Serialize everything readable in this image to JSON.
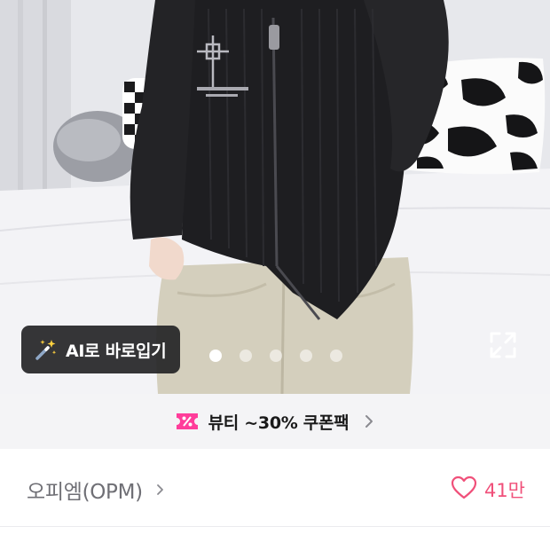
{
  "product_image": {
    "ai_fitting_label": "AI로 바로입기",
    "image_count": 5,
    "active_index": 0,
    "icons": {
      "ai_fitting": "magic-wand-icon",
      "expand": "fullscreen-expand-icon"
    }
  },
  "promo": {
    "text": "뷰티 ~30% 쿠폰팩",
    "icon": "coupon-percent-icon",
    "accent_color": "#ff3d9a"
  },
  "brand": {
    "name": "오피엠(OPM)",
    "like_count": "41만",
    "like_color": "#f0507a"
  }
}
